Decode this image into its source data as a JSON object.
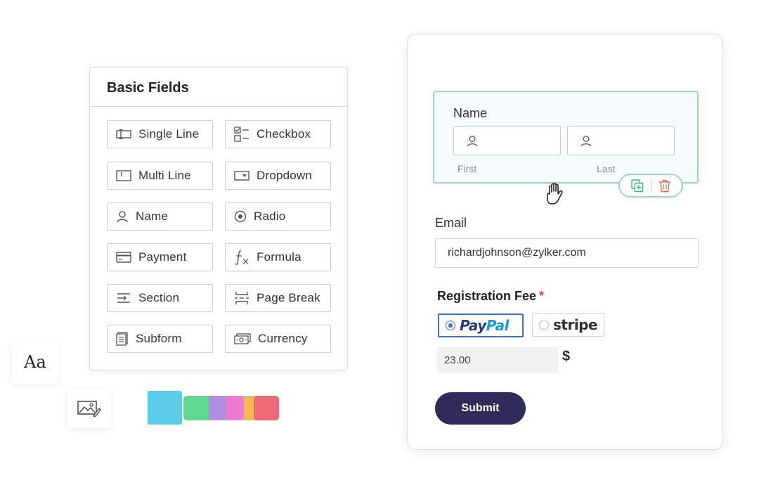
{
  "basic_fields": {
    "title": "Basic Fields",
    "items": [
      {
        "label": "Single Line",
        "icon": "single-line-icon"
      },
      {
        "label": "Checkbox",
        "icon": "checkbox-icon"
      },
      {
        "label": "Multi Line",
        "icon": "multi-line-icon"
      },
      {
        "label": "Dropdown",
        "icon": "dropdown-icon"
      },
      {
        "label": "Name",
        "icon": "person-icon"
      },
      {
        "label": "Radio",
        "icon": "radio-icon"
      },
      {
        "label": "Payment",
        "icon": "card-icon"
      },
      {
        "label": "Formula",
        "icon": "formula-icon"
      },
      {
        "label": "Section",
        "icon": "section-icon"
      },
      {
        "label": "Page Break",
        "icon": "page-break-icon"
      },
      {
        "label": "Subform",
        "icon": "subform-icon"
      },
      {
        "label": "Currency",
        "icon": "currency-icon"
      }
    ]
  },
  "tools": {
    "font_label": "Aa",
    "swatch_colors": [
      "#5ccbe8",
      "#5fd98f",
      "#b08de0",
      "#ee7ad0",
      "#f6b756",
      "#ee6a78"
    ]
  },
  "form": {
    "name_label": "Name",
    "first_label": "First",
    "last_label": "Last",
    "email_label": "Email",
    "email_value": "richardjohnson@zylker.com",
    "fee_label": "Registration Fee",
    "required_mark": "*",
    "paypal_part1": "Pay",
    "paypal_part2": "Pal",
    "stripe_label": "stripe",
    "amount": "23.00",
    "currency_symbol": "$",
    "submit_label": "Submit"
  },
  "colors": {
    "accent_green": "#9ad9b9",
    "submit_bg": "#2f2c5c",
    "selected_blue": "#3a72c8",
    "required_red": "#e04b4b"
  }
}
